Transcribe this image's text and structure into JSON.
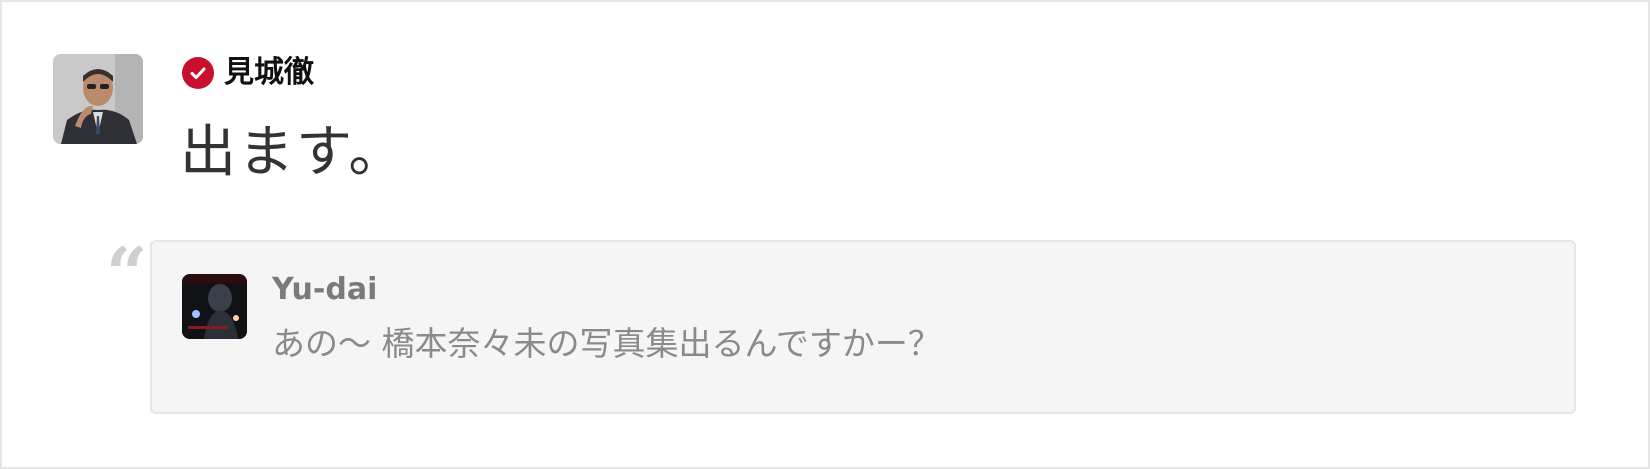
{
  "post": {
    "author": {
      "name": "見城徹",
      "verified_icon": "verified-check-icon",
      "avatar": "author-avatar-photo"
    },
    "text": "出ます。"
  },
  "quote": {
    "icon": "quote-mark-icon",
    "author": {
      "name": "Yu-dai",
      "avatar": "quoted-avatar-photo"
    },
    "text": "あの～ 橋本奈々未の写真集出るんですかー？"
  },
  "colors": {
    "verified": "#c8102e",
    "quote_background": "#f5f5f5",
    "border": "#e6e6e6"
  }
}
